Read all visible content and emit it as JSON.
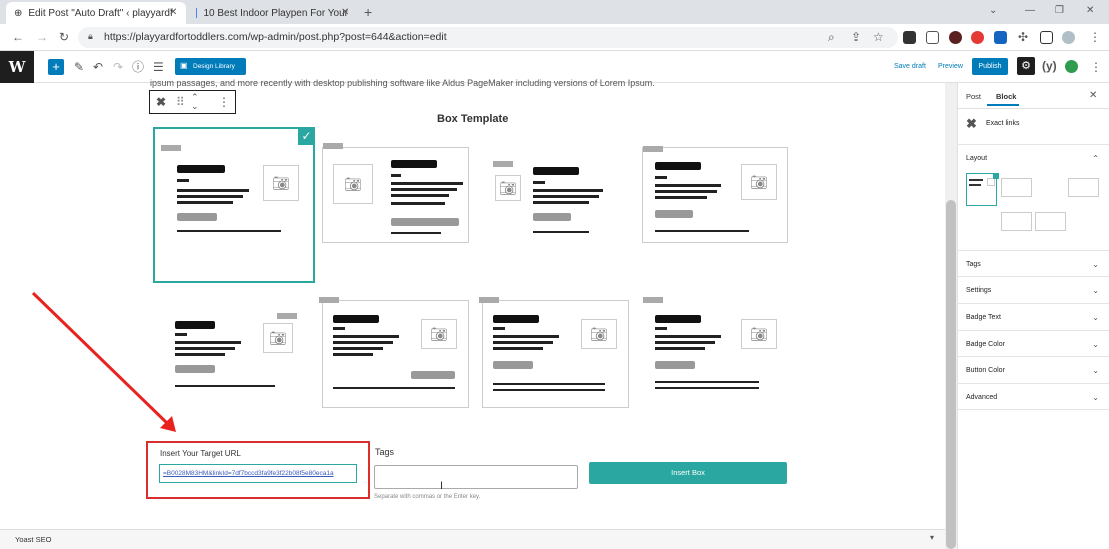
{
  "browser": {
    "tabs": [
      {
        "title": "Edit Post \"Auto Draft\" ‹ playyardf",
        "active": true
      },
      {
        "title": "10 Best Indoor Playpen For Your",
        "active": false
      }
    ],
    "new_tab": "+",
    "url": "https://playyardfortoddlers.com/wp-admin/post.php?post=644&action=edit"
  },
  "toolbar": {
    "design_library_label": "Design Library",
    "save_draft_label": "Save draft",
    "preview_label": "Preview",
    "publish_label": "Publish"
  },
  "editor": {
    "top_text": "ipsum passages, and more recently with desktop publishing software like Aldus PageMaker including versions of Lorem Ipsum.",
    "box_template_title": "Box Template",
    "url_field": {
      "label": "Insert Your Target URL",
      "value": "=B0028M83HM&linkId=7df7bccd3fa9fe3f22b08f5e80eca1a"
    },
    "tags_field": {
      "label": "Tags",
      "value": "",
      "help": "Separate with commas or the Enter key."
    },
    "insert_button_label": "Insert Box",
    "yoast_label": "Yoast SEO"
  },
  "sidebar": {
    "tabs": [
      "Post",
      "Block"
    ],
    "active_tab": "Block",
    "block_name": "Exact links",
    "sections": [
      "Layout",
      "Tags",
      "Settings",
      "Badge Text",
      "Badge Color",
      "Button Color",
      "Advanced"
    ]
  },
  "colors": {
    "accent": "#2aa7a0",
    "wp_blue": "#007cba",
    "annotation_red": "#d9302d"
  }
}
